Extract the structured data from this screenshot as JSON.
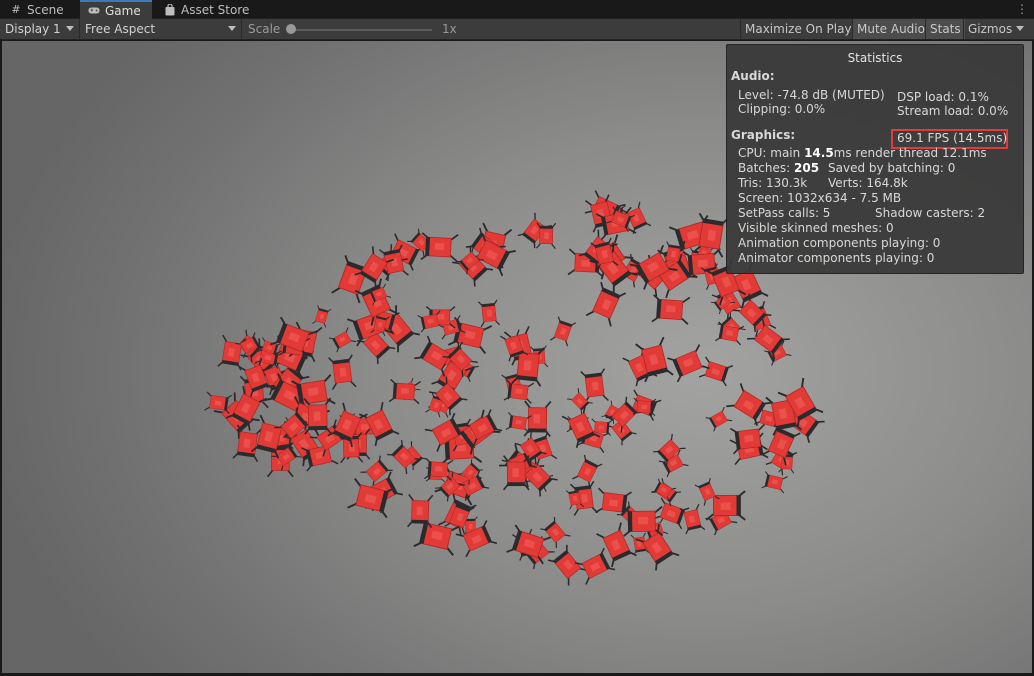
{
  "tabs": [
    {
      "label": "Scene",
      "icon": "hash-grid-icon",
      "active": false
    },
    {
      "label": "Game",
      "icon": "gamepad-icon",
      "active": true
    },
    {
      "label": "Asset Store",
      "icon": "shopping-bag-icon",
      "active": false
    }
  ],
  "toolbar": {
    "display": "Display 1",
    "aspect": "Free Aspect",
    "scale_label": "Scale",
    "scale_value": "1x",
    "maximize": "Maximize On Play",
    "mute": "Mute Audio",
    "stats": "Stats",
    "gizmos": "Gizmos"
  },
  "stats": {
    "title": "Statistics",
    "audio_header": "Audio:",
    "level": "Level: -74.8 dB (MUTED)",
    "clipping": "Clipping: 0.0%",
    "dsp": "DSP load: 0.1%",
    "stream": "Stream load: 0.0%",
    "graphics_header": "Graphics:",
    "fps": "69.1 FPS (14.5ms)",
    "cpu_prefix": "CPU: main ",
    "cpu_main": "14.5",
    "cpu_suffix": "ms  render thread 12.1ms",
    "batches_prefix": "Batches: ",
    "batches": "205",
    "saved": "Saved by batching: 0",
    "tris": "Tris: 130.3k",
    "verts": "Verts: 164.8k",
    "screen": "Screen: 1032x634 - 7.5 MB",
    "setpass": "SetPass calls: 5",
    "shadow": "Shadow casters: 2",
    "skinned": "Visible skinned meshes: 0",
    "anim": "Animation components playing: 0",
    "animator": "Animator components playing: 0"
  },
  "colors": {
    "accent": "#3a79bb",
    "highlight_box": "#e23b3b",
    "object_red": "#e23a36",
    "object_dark": "#2b2b2e"
  }
}
